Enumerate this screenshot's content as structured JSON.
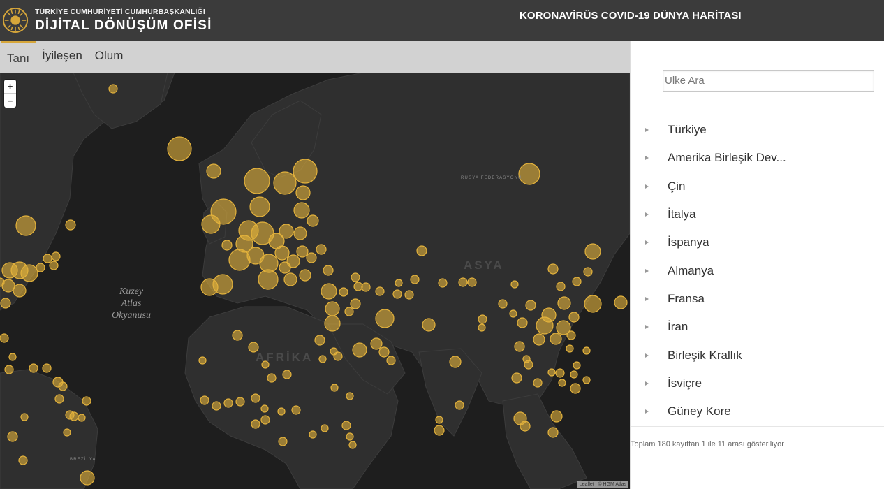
{
  "header": {
    "org_top": "TÜRKİYE CUMHURİYETİ CUMHURBAŞKANLIĞI",
    "org_name": "DİJİTAL DÖNÜŞÜM OFİSİ",
    "title": "KORONAVİRÜS COVID-19 DÜNYA HARİTASI"
  },
  "tabs": [
    {
      "label": "Tanı",
      "active": true
    },
    {
      "label": "İyileşen",
      "active": false
    },
    {
      "label": "Olum",
      "active": false
    }
  ],
  "map": {
    "zoom_in": "+",
    "zoom_out": "−",
    "ocean_label": "Kuzey Atlas Okyanusu",
    "continent_africa": "AFRİKA",
    "continent_asia": "ASYA",
    "label_russia": "RUSYA FEDERASYONU",
    "label_brazil": "BREZİLYA",
    "attribution": "Leaflet | © HGM Atlas",
    "marker_color": "#e3b23c",
    "land_color": "#2f2f2f",
    "sea_color": "#1e1e1e"
  },
  "sidebar": {
    "search_placeholder": "Ulke Ara",
    "countries": [
      "Türkiye",
      "Amerika Birleşik Dev...",
      "Çin",
      "İtalya",
      "İspanya",
      "Almanya",
      "Fransa",
      "İran",
      "Birleşik Krallık",
      "İsviçre",
      "Güney Kore"
    ],
    "footer_info": "Toplam 180 kayıttan 1 ile 11 arası gösteriliyor"
  }
}
